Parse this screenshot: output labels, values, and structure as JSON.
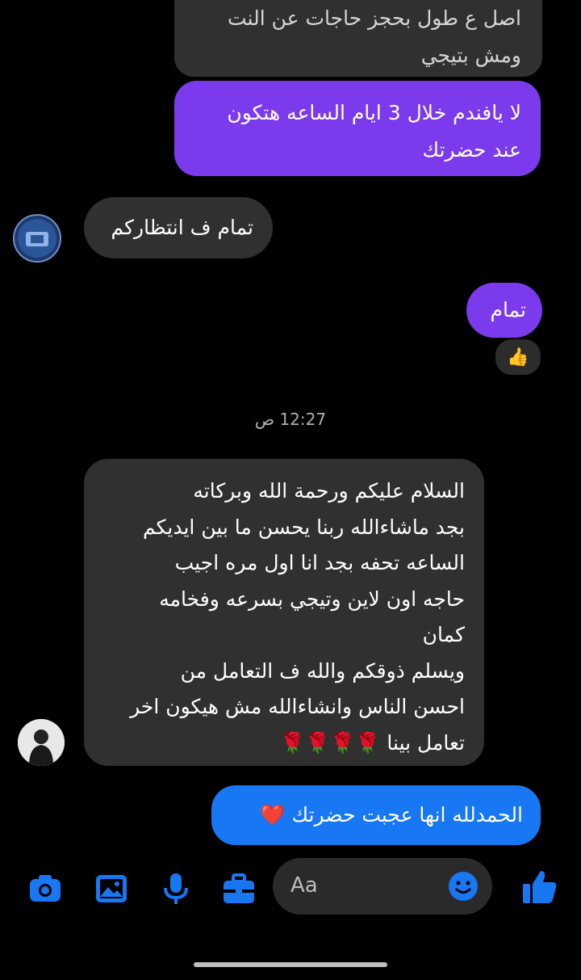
{
  "messages": [
    {
      "id": "b1",
      "lines": [
        "اصل ع طول بحجز حاجات عن النت",
        "ومش بتيجي"
      ]
    },
    {
      "id": "b2",
      "lines": [
        "لا يافندم خلال 3 ايام الساعه هتكون",
        "عند حضرتك"
      ]
    },
    {
      "id": "b3",
      "lines": [
        "تمام ف انتظاركم"
      ]
    },
    {
      "id": "b4",
      "lines": [
        "تمام"
      ]
    },
    {
      "id": "b5",
      "lines": [
        "السلام عليكم ورحمة الله وبركاته",
        "بجد ماشاءالله ربنا يحسن ما بين ايديكم",
        "الساعه تحفه بجد انا اول مره اجيب",
        "حاجه اون لاين وتيجي بسرعه وفخامه",
        "كمان",
        "ويسلم ذوقكم والله ف التعامل من",
        "احسن الناس وانشاءالله مش هيكون اخر",
        "تعامل بينا"
      ],
      "emoji": "🌹🌹🌹🌹"
    },
    {
      "id": "b6",
      "lines": [
        "الحمدلله انها عجبت حضرتك"
      ],
      "emoji": "❤️"
    }
  ],
  "reaction": "👍",
  "timestamp": "12:27 ص",
  "composer": {
    "placeholder": "Aa"
  },
  "icons": {
    "toolbar": [
      "camera-icon",
      "gallery-icon",
      "microphone-icon",
      "briefcase-icon"
    ],
    "emoji": "smiley-icon",
    "like": "thumbs-up-icon"
  },
  "colors": {
    "incoming": "#303030",
    "outgoing_purple": "#7c3aed",
    "outgoing_blue": "#1877f2",
    "accent": "#1877f2"
  }
}
